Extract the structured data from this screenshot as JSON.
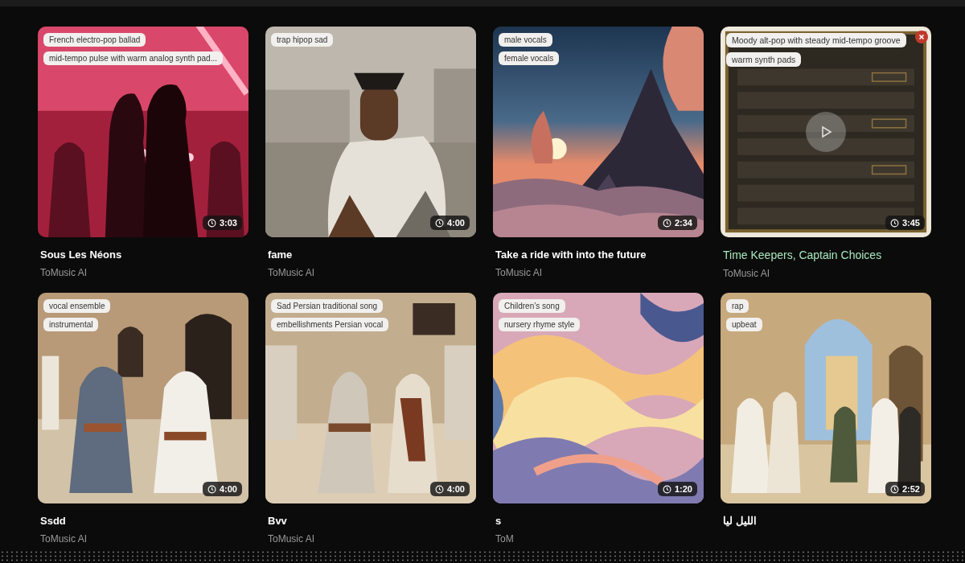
{
  "cards": [
    {
      "title": "Sous Les Néons",
      "artist": "ToMusic AI",
      "tags": [
        "French electro-pop ballad",
        "mid-tempo pulse with warm analog synth pad..."
      ],
      "duration": "3:03",
      "hovered": false
    },
    {
      "title": "fame",
      "artist": "ToMusic AI",
      "tags": [
        "trap hipop sad"
      ],
      "duration": "4:00",
      "hovered": false
    },
    {
      "title": "Take a ride with into the future",
      "artist": "ToMusic AI",
      "tags": [
        "male vocals",
        "female vocals"
      ],
      "duration": "2:34",
      "hovered": false
    },
    {
      "title": "Time Keepers, Captain Choices",
      "artist": "ToMusic AI",
      "tags": [
        "Moody alt-pop with steady mid-tempo groove",
        "warm synth pads"
      ],
      "duration": "3:45",
      "hovered": true
    },
    {
      "title": "Ssdd",
      "artist": "ToMusic AI",
      "tags": [
        "vocal ensemble",
        "instrumental"
      ],
      "duration": "4:00",
      "hovered": false
    },
    {
      "title": "Bvv",
      "artist": "ToMusic AI",
      "tags": [
        "Sad Persian traditional song",
        "embellishments Persian vocal"
      ],
      "duration": "4:00",
      "hovered": false
    },
    {
      "title": "s",
      "artist": "ToM",
      "tags": [
        "Children’s song",
        "nursery rhyme style"
      ],
      "duration": "1:20",
      "hovered": false
    },
    {
      "title": "الليل ليا",
      "tags": [
        "rap",
        "upbeat"
      ],
      "duration": "2:52",
      "hovered": false
    }
  ]
}
